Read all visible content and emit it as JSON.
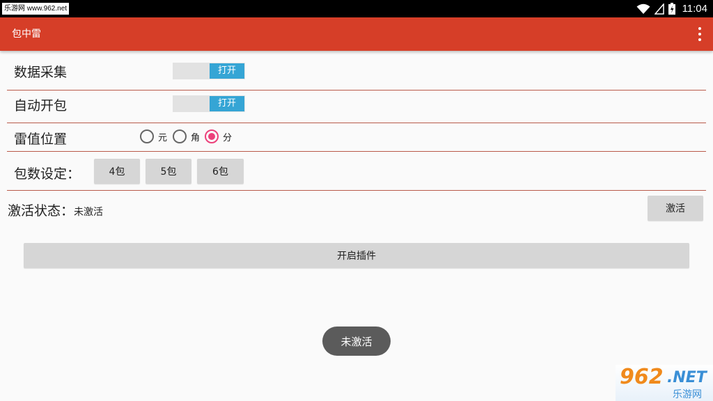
{
  "status_bar": {
    "watermark": "乐游网 www.962.net",
    "time": "11:04"
  },
  "app_bar": {
    "title": "包中雷",
    "overflow_icon": "more-vertical-icon"
  },
  "settings": {
    "data_collect": {
      "label": "数据采集",
      "toggle_label": "打开"
    },
    "auto_open": {
      "label": "自动开包",
      "toggle_label": "打开"
    },
    "mine_position": {
      "label": "雷值位置",
      "options": [
        "元",
        "角",
        "分"
      ],
      "selected": "分"
    },
    "pack_count": {
      "label": "包数设定：",
      "buttons": [
        "4包",
        "5包",
        "6包"
      ]
    },
    "activation": {
      "label": "激活状态：",
      "value": "未激活",
      "button": "激活"
    }
  },
  "main_button": "开启插件",
  "toast": "未激活",
  "corner_logo": {
    "brand_num": "962",
    "brand_net": ".NET",
    "brand_cn": "乐游网"
  },
  "colors": {
    "app_bar": "#d63e28",
    "toggle_on": "#35a5d5",
    "radio_checked": "#ec407a",
    "divider": "#b95a4a"
  }
}
